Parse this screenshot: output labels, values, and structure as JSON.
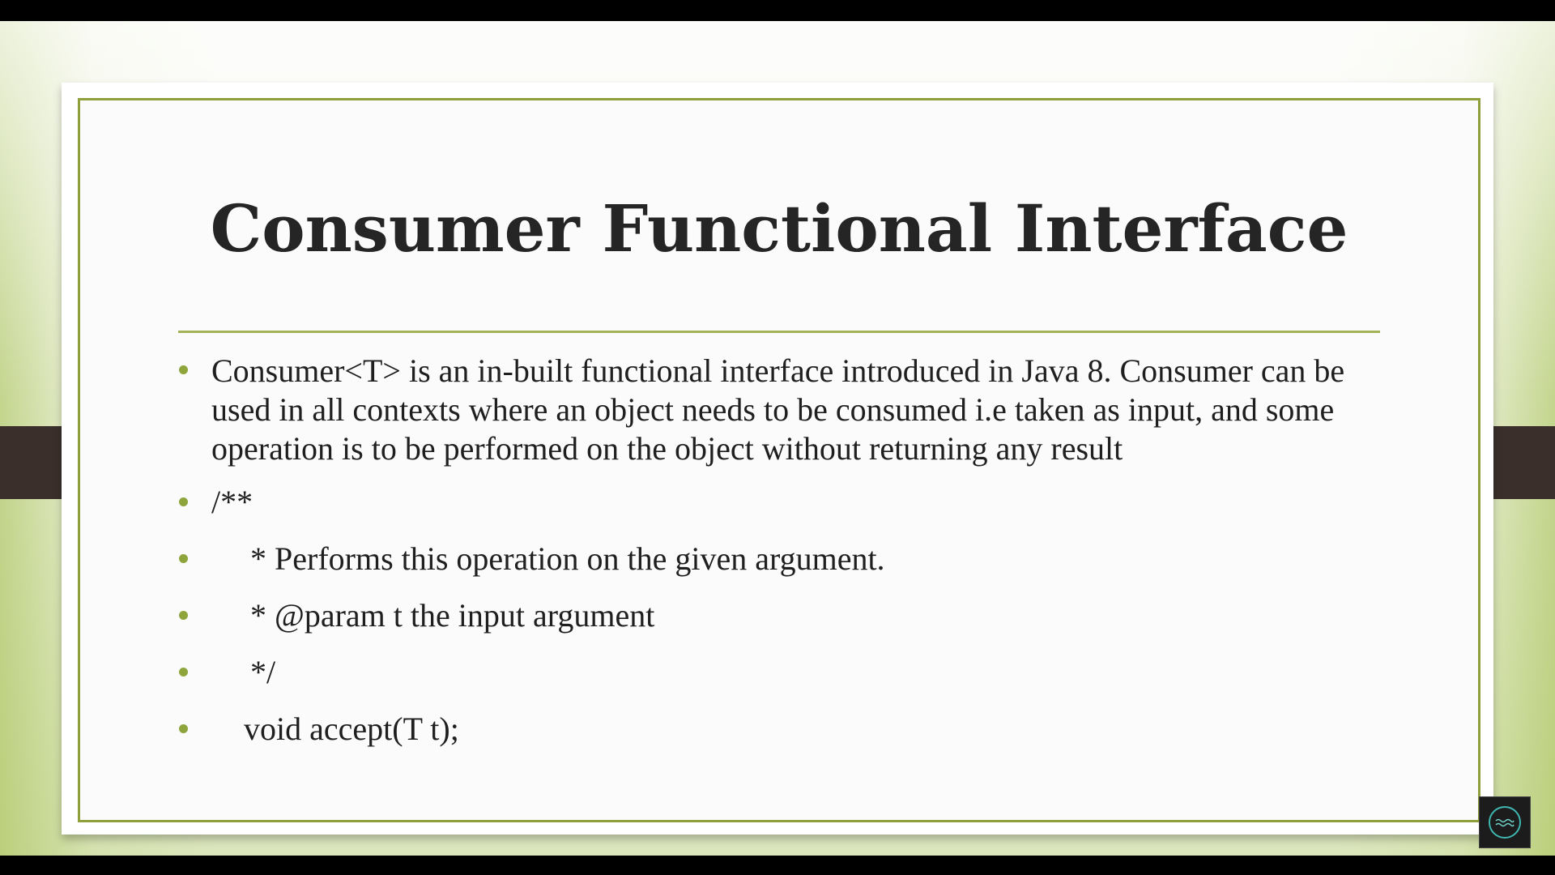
{
  "slide": {
    "title": "Consumer Functional Interface",
    "bullets": [
      "Consumer<T> is an in-built functional interface introduced in Java 8. Consumer can be used in all contexts where an object needs to be consumed i.e taken as input, and some operation is to be performed on the object without returning any result",
      "/**",
      "* Performs this operation on the given argument.",
      "* @param t the input argument",
      "*/",
      "void accept(T t);"
    ]
  },
  "colors": {
    "accent": "#8ea53c",
    "frame": "#8e9f3b",
    "title_text": "#252525",
    "side_bars": "#3a2f2a"
  },
  "overlay": {
    "badge_icon": "channel-logo-icon"
  }
}
